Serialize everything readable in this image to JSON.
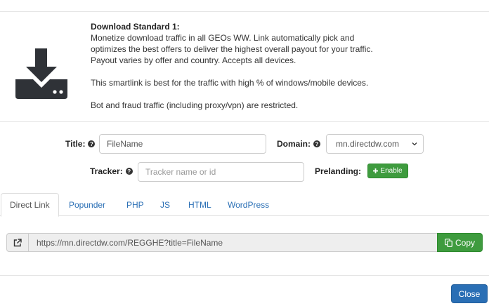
{
  "info": {
    "title": "Download Standard 1:",
    "lines": [
      "Monetize download traffic in all GEOs WW. Link automatically pick and",
      "optimizes the best offers to deliver the highest overall payout for your traffic.",
      "Payout varies by offer and country. Accepts all devices."
    ],
    "note1": "This smartlink is best for the traffic with high % of windows/mobile devices.",
    "note2": "Bot and fraud traffic (including proxy/vpn) are restricted.",
    "icon": "download-tray-icon"
  },
  "form": {
    "title_label": "Title:",
    "title_value": "FileName",
    "domain_label": "Domain:",
    "domain_value": "mn.directdw.com",
    "tracker_label": "Tracker:",
    "tracker_placeholder": "Tracker name or id",
    "prelanding_label": "Prelanding:",
    "enable_label": "Enable",
    "help_glyph": "?"
  },
  "tabs": [
    {
      "label": "Direct Link",
      "active": true
    },
    {
      "label": "Popunder"
    },
    {
      "label": "PHP"
    },
    {
      "label": "JS"
    },
    {
      "label": "HTML"
    },
    {
      "label": "WordPress"
    }
  ],
  "link": {
    "url": "https://mn.directdw.com/REGGHE?title=FileName",
    "copy_label": "Copy"
  },
  "footer": {
    "close_label": "Close"
  },
  "colors": {
    "green": "#3e9b3e",
    "blue": "#2a6fb5"
  }
}
